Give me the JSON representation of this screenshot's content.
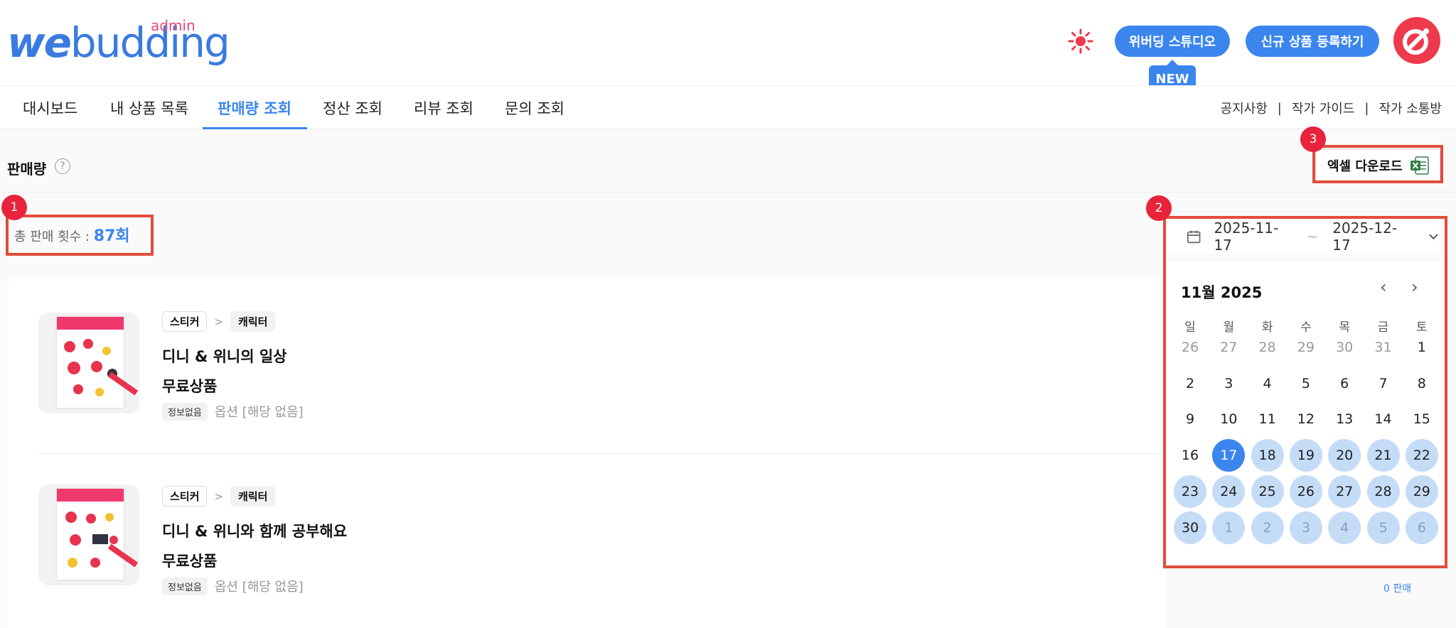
{
  "header": {
    "logo_main_we": "we",
    "logo_main_rest": "budding",
    "logo_admin": "admin",
    "studio_button": "위버딩 스튜디오",
    "new_badge": "NEW",
    "register_button": "신규 상품 등록하기"
  },
  "nav": {
    "tabs": [
      "대시보드",
      "내 상품 목록",
      "판매량 조회",
      "정산 조회",
      "리뷰 조회",
      "문의 조회"
    ],
    "active_tab": "판매량 조회",
    "links": [
      "공지사항",
      "작가 가이드",
      "작가 소통방"
    ],
    "separator": "|"
  },
  "sales": {
    "title": "판매량",
    "help": "?",
    "excel_button": "엑셀 다운로드",
    "total_label": "총 판매 횟수 : ",
    "total_value": "87회"
  },
  "date_range": {
    "start": "2025-11-17",
    "separator": "~",
    "end": "2025-12-17"
  },
  "calendar": {
    "title": "11월 2025",
    "prev": "‹",
    "next": "›",
    "weekdays": [
      "일",
      "월",
      "화",
      "수",
      "목",
      "금",
      "토"
    ],
    "weeks": [
      [
        "26",
        "27",
        "28",
        "29",
        "30",
        "31",
        "1"
      ],
      [
        "2",
        "3",
        "4",
        "5",
        "6",
        "7",
        "8"
      ],
      [
        "9",
        "10",
        "11",
        "12",
        "13",
        "14",
        "15"
      ],
      [
        "16",
        "17",
        "18",
        "19",
        "20",
        "21",
        "22"
      ],
      [
        "23",
        "24",
        "25",
        "26",
        "27",
        "28",
        "29"
      ],
      [
        "30",
        "1",
        "2",
        "3",
        "4",
        "5",
        "6"
      ]
    ],
    "selected": "17"
  },
  "annotations": [
    "1",
    "2",
    "3"
  ],
  "products": [
    {
      "category": "스티커",
      "subcategory": "캐릭터",
      "crumb_sep": ">",
      "name": "디니 & 위니의 일상",
      "price": "무료상품",
      "info_chip": "정보없음",
      "option": "옵션 [해당 없음]"
    },
    {
      "category": "스티커",
      "subcategory": "캐릭터",
      "crumb_sep": ">",
      "name": "디니 & 위니와 함께 공부해요",
      "price": "무료상품",
      "info_chip": "정보없음",
      "option": "옵션 [해당 없음]"
    }
  ],
  "sales_count": "0 판매",
  "colors": {
    "accent": "#3a86ee",
    "brand_pink": "#e8487a",
    "annotation": "#e14c3c",
    "range": "#c5dcf7"
  }
}
